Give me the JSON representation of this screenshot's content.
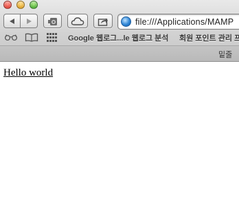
{
  "window": {
    "traffic_lights": [
      "close",
      "minimize",
      "zoom"
    ],
    "colors": {
      "close": "#e0443a",
      "minimize": "#e0a32a",
      "zoom": "#4fb035"
    }
  },
  "toolbar": {
    "back_icon": "triangle-left",
    "forward_icon": "triangle-right",
    "snapshot_icon": "camera",
    "cloud_icon": "cloud",
    "share_icon": "share-arrow",
    "address": {
      "icon": "globe",
      "value": "file:///Applications/MAMP"
    }
  },
  "bookmarks": {
    "reading_list_icon": "glasses",
    "bookmarks_icon": "open-book",
    "top_sites_icon": "grid",
    "items": [
      {
        "label": "Google 웹로그...le 웹로그 분석"
      },
      {
        "label": "회원 포인트 관리 프"
      }
    ]
  },
  "tabs": {
    "active_label": "밑줄"
  },
  "content": {
    "link_text": "Hello world"
  }
}
